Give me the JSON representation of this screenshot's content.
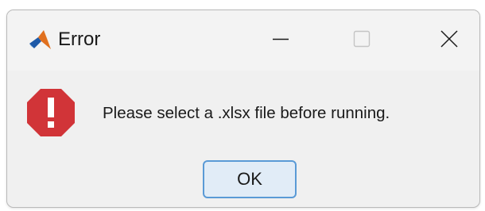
{
  "window": {
    "title": "Error",
    "app_icon": "matlab-icon",
    "controls": {
      "minimize_icon": "minimize-icon",
      "maximize_icon": "maximize-icon",
      "close_icon": "close-icon"
    }
  },
  "dialog": {
    "status_icon": "error-icon",
    "message": "Please select a .xlsx file before running.",
    "ok_label": "OK"
  },
  "colors": {
    "error_red": "#d13438",
    "button_fill": "#e1ecf7",
    "button_border": "#5a9ad6",
    "window_bg": "#f0f0f0"
  }
}
